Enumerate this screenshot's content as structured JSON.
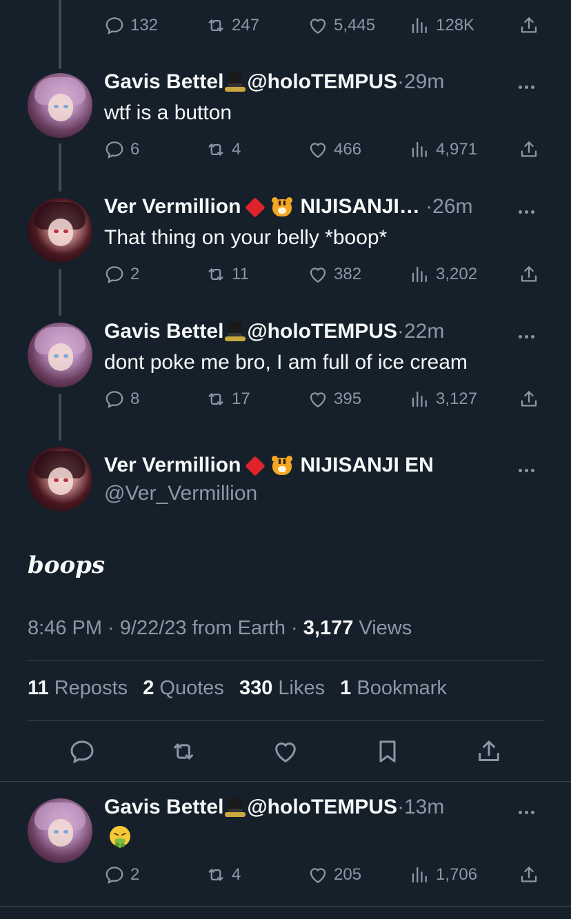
{
  "top_stats": {
    "replies": "132",
    "reposts": "247",
    "likes": "5,445",
    "views": "128K"
  },
  "tweets": [
    {
      "name": "Gavis Bettel",
      "handle": "@holoTEMPUS",
      "dot": "·",
      "time": "29m",
      "text": "wtf is a button",
      "replies": "6",
      "reposts": "4",
      "likes": "466",
      "views": "4,971"
    },
    {
      "name": "Ver Vermillion",
      "affiliation": "NIJISANJI…",
      "dot": "·",
      "time": "26m",
      "text": "That thing on your belly *boop*",
      "replies": "2",
      "reposts": "11",
      "likes": "382",
      "views": "3,202"
    },
    {
      "name": "Gavis Bettel",
      "handle": "@holoTEMPUS",
      "dot": "·",
      "time": "22m",
      "text": "dont poke me bro, I am full of ice cream",
      "replies": "8",
      "reposts": "17",
      "likes": "395",
      "views": "3,127"
    }
  ],
  "main_tweet": {
    "name": "Ver Vermillion",
    "affiliation": "NIJISANJI EN",
    "handle": "@Ver_Vermillion",
    "text": "boops",
    "time": "8:46 PM",
    "sep1": "·",
    "date": "9/22/23 from Earth",
    "sep2": "·",
    "views_count": "3,177",
    "views_label": "Views",
    "reposts_count": "11",
    "reposts_label": "Reposts",
    "quotes_count": "2",
    "quotes_label": "Quotes",
    "likes_count": "330",
    "likes_label": "Likes",
    "bookmarks_count": "1",
    "bookmarks_label": "Bookmark"
  },
  "reply": {
    "name": "Gavis Bettel",
    "handle": "@holoTEMPUS",
    "dot": "·",
    "time": "13m",
    "replies": "2",
    "reposts": "4",
    "likes": "205",
    "views": "1,706"
  },
  "colors": {
    "background": "#15202b",
    "text": "#f7f9f9",
    "secondary": "#8b98a5",
    "divider": "#38444d"
  },
  "icons": [
    "reply-icon",
    "repost-icon",
    "like-icon",
    "views-icon",
    "share-icon",
    "bookmark-icon",
    "more-icon",
    "top-hat-icon",
    "red-diamond-icon",
    "tiger-icon",
    "nauseated-face-icon"
  ]
}
